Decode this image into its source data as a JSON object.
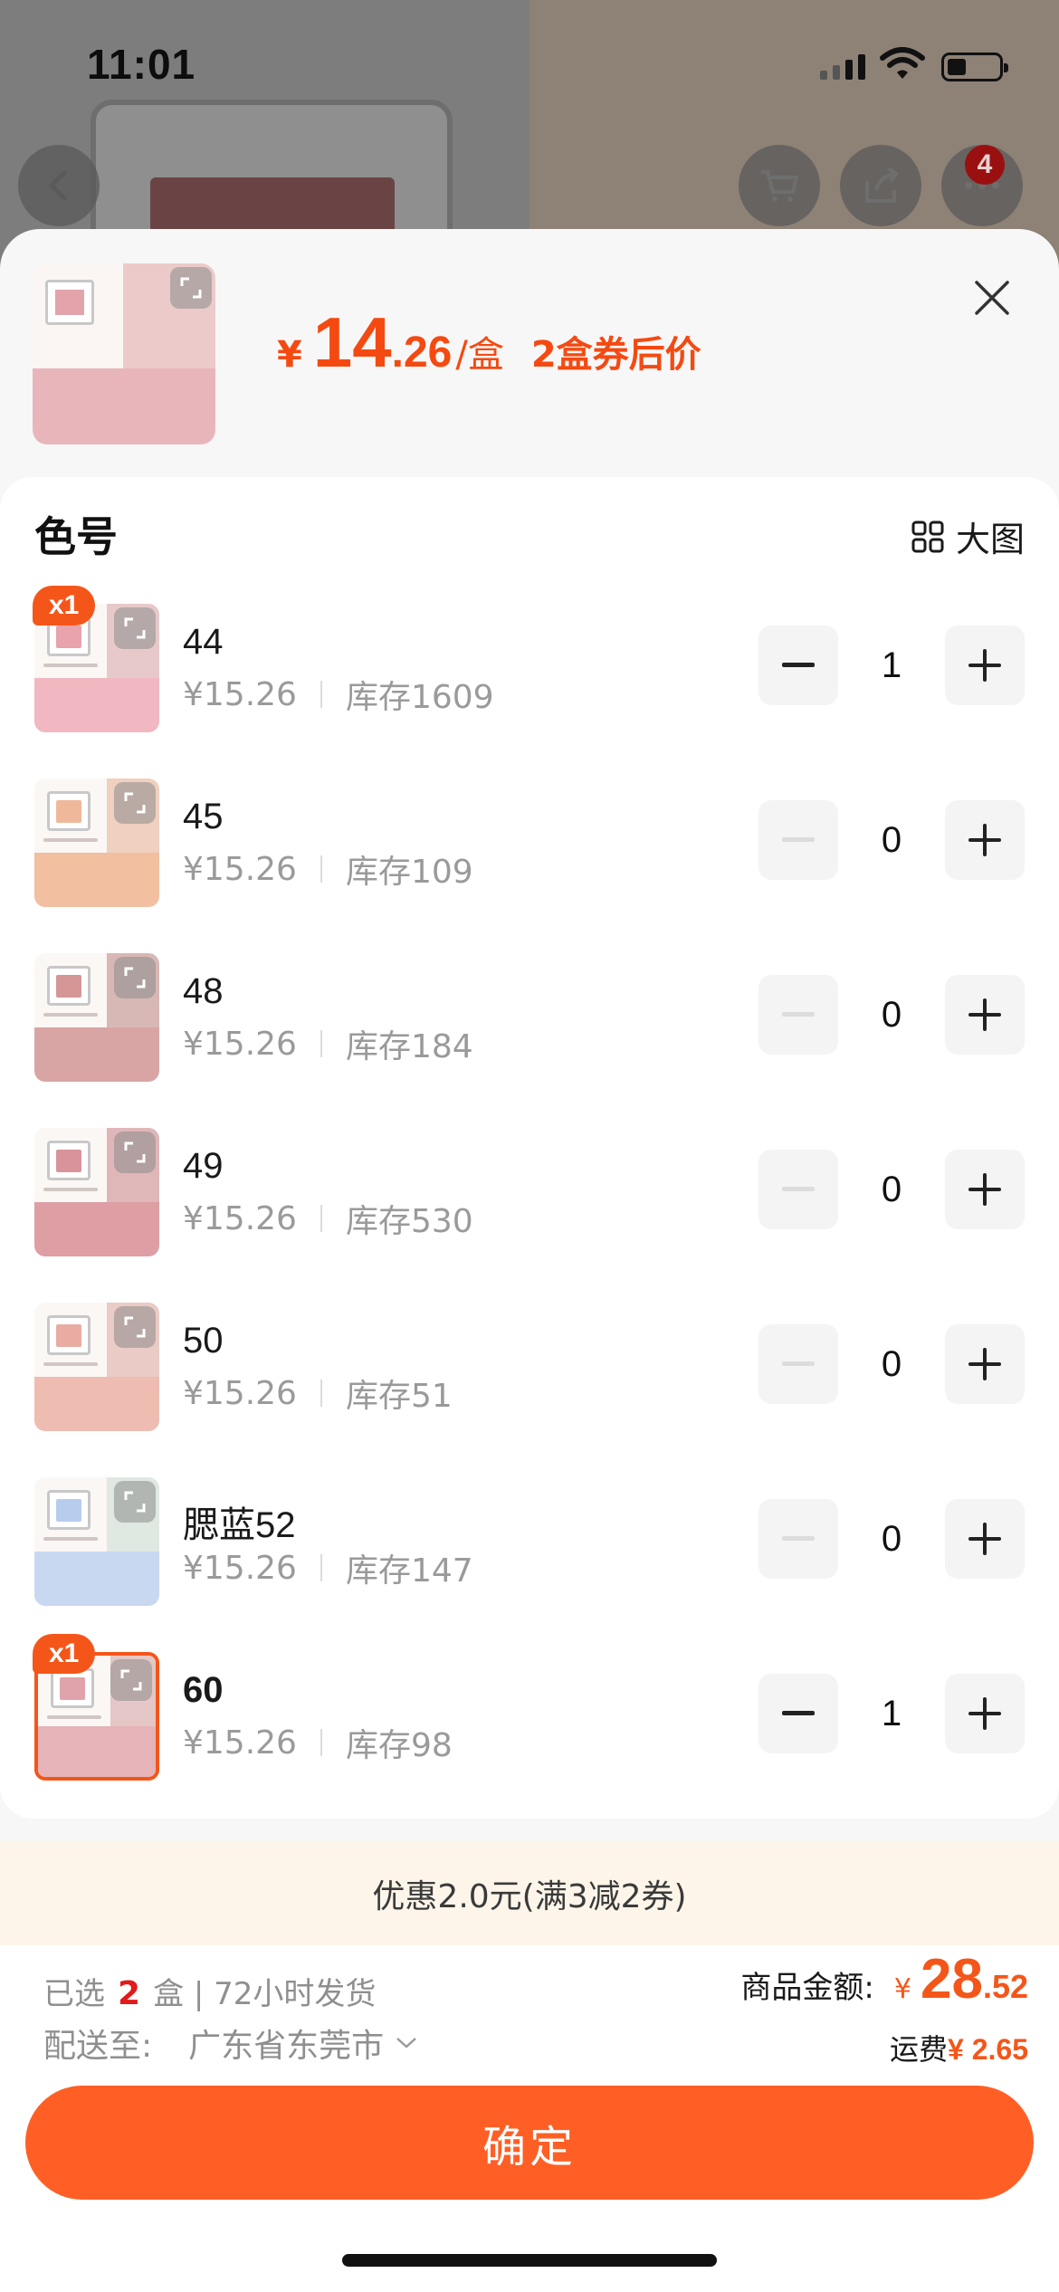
{
  "status_bar": {
    "time": "11:01"
  },
  "background": {
    "cart_badge": "4"
  },
  "header": {
    "currency": "¥",
    "price_int": "14",
    "price_dec": ".26",
    "unit": "/盒",
    "coupon_note": "2盒券后价"
  },
  "section": {
    "title": "色号",
    "big_view_label": "大图"
  },
  "items": [
    {
      "name": "44",
      "price": "¥15.26",
      "stock": "库存1609",
      "qty": "1",
      "badge": "x1",
      "swatch": "#e8a3ac",
      "bottom": "#f1b8c2",
      "blur": "#e7c9c9"
    },
    {
      "name": "45",
      "price": "¥15.26",
      "stock": "库存109",
      "qty": "0",
      "badge": "",
      "swatch": "#f0b89a",
      "bottom": "#f2bfa0",
      "blur": "#f0d0c0"
    },
    {
      "name": "48",
      "price": "¥15.26",
      "stock": "库存184",
      "qty": "0",
      "badge": "",
      "swatch": "#d49796",
      "bottom": "#d9a5a4",
      "blur": "#d8b8b4"
    },
    {
      "name": "49",
      "price": "¥15.26",
      "stock": "库存530",
      "qty": "0",
      "badge": "",
      "swatch": "#d8949a",
      "bottom": "#dd9ea4",
      "blur": "#e0b7b9"
    },
    {
      "name": "50",
      "price": "¥15.26",
      "stock": "库存51",
      "qty": "0",
      "badge": "",
      "swatch": "#e9aca2",
      "bottom": "#efbcb2",
      "blur": "#eacbc6"
    },
    {
      "name": "腮蓝52",
      "price": "¥15.26",
      "stock": "库存147",
      "qty": "0",
      "badge": "",
      "swatch": "#b7cdee",
      "bottom": "#c8d8f1",
      "blur": "#e0e8e2"
    },
    {
      "name": "60",
      "price": "¥15.26",
      "stock": "库存98",
      "qty": "1",
      "badge": "x1",
      "swatch": "#e1a3ab",
      "bottom": "#e6b3b8",
      "blur": "#e4c7c6"
    }
  ],
  "promo": {
    "text": "优惠2.0元(满3减2券)"
  },
  "summary": {
    "selected_prefix": "已选",
    "selected_count": "2",
    "selected_suffix": "盒 | 72小时发货",
    "ship_label": "配送至:",
    "ship_location": "广东省东莞市",
    "amount_label": "商品金额:",
    "amount_currency": "¥",
    "amount_int": "28",
    "amount_dec": ".52",
    "fee_label": "运费",
    "fee_value": "¥ 2.65"
  },
  "confirm_label": "确定",
  "colors": {
    "accent": "#f4561a",
    "button": "#ff5f25",
    "promo_bg": "#fdf5e9"
  }
}
